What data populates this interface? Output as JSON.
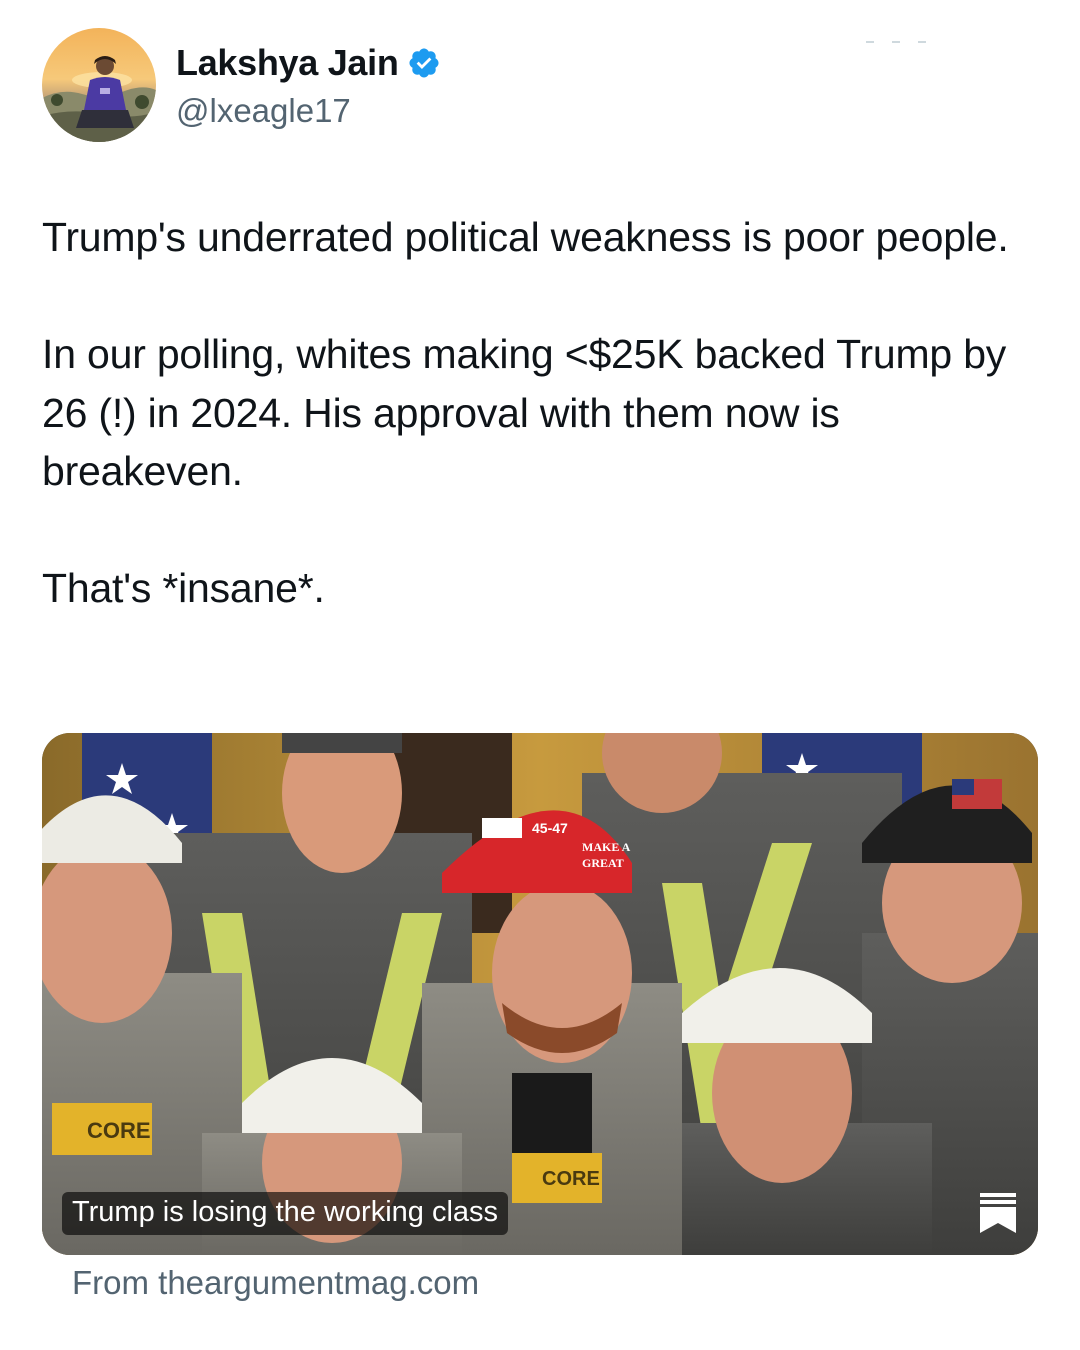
{
  "author": {
    "display_name": "Lakshya Jain",
    "handle": "@lxeagle17",
    "verified": true
  },
  "tweet": {
    "paragraphs": [
      "Trump's underrated political weakness is poor people.",
      "In our polling, whites making <$25K backed Trump by 26 (!) in 2024. His approval with them now is breakeven.",
      "That's *insane*."
    ]
  },
  "link_card": {
    "title": "Trump is losing the working class",
    "source": "From theargumentmag.com",
    "helmet_labels": [
      "45-47",
      "MAKE A",
      "GREAT"
    ],
    "badge_labels": [
      "CORE",
      "CORE"
    ]
  },
  "colors": {
    "verified_blue": "#1d9bf0",
    "text_primary": "#0f1419",
    "text_secondary": "#536471"
  },
  "icons": {
    "verified": "verified-badge-icon",
    "publication": "bookmark-stack-icon"
  }
}
